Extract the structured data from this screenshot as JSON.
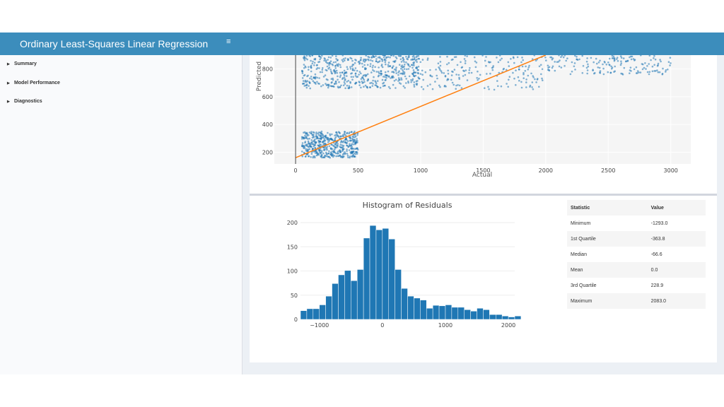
{
  "header": {
    "title": "Ordinary Least-Squares Linear Regression",
    "menu_icon": "hamburger-icon"
  },
  "sidebar": {
    "items": [
      {
        "label": "Summary",
        "icon": "caret-right-icon"
      },
      {
        "label": "Model Performance",
        "icon": "caret-right-icon"
      },
      {
        "label": "Diagnostics",
        "icon": "caret-right-icon"
      }
    ]
  },
  "colors": {
    "header": "#3c8dbc",
    "points": "#1f77b4",
    "fit_line": "#ff7f0e",
    "bars": "#1f77b4"
  },
  "chart_data": [
    {
      "type": "scatter",
      "xlabel": "Actual",
      "ylabel": "Predicted",
      "x_ticks": [
        "0",
        "500",
        "1000",
        "1500",
        "2000",
        "2500",
        "3000"
      ],
      "y_ticks": [
        "200",
        "400",
        "600",
        "800"
      ],
      "xlim": [
        -170,
        3160
      ],
      "ylim": [
        115,
        900
      ],
      "grid": true,
      "fit_line": {
        "x": [
          0,
          2000
        ],
        "y": [
          160,
          900
        ]
      },
      "clusters": [
        {
          "x": [
            50,
            500
          ],
          "y": [
            160,
            350
          ],
          "n": 500
        },
        {
          "x": [
            50,
            1000
          ],
          "y": [
            660,
            900
          ],
          "n": 550
        },
        {
          "x": [
            900,
            1980
          ],
          "y": [
            650,
            900
          ],
          "n": 200
        },
        {
          "x": [
            1950,
            3000
          ],
          "y": [
            760,
            900
          ],
          "n": 170
        }
      ]
    },
    {
      "type": "bar",
      "title": "Histogram of Residuals",
      "x_ticks": [
        "−1000",
        "0",
        "1000",
        "2000"
      ],
      "y_ticks": [
        "0",
        "50",
        "100",
        "150",
        "200"
      ],
      "xlim": [
        -1300,
        2100
      ],
      "ylim": [
        0,
        200
      ],
      "bin_start": -1300,
      "bin_width": 100,
      "values": [
        18,
        22,
        22,
        30,
        48,
        74,
        92,
        101,
        80,
        103,
        168,
        194,
        185,
        188,
        166,
        103,
        64,
        48,
        44,
        40,
        23,
        29,
        28,
        30,
        25,
        25,
        20,
        17,
        23,
        20,
        10,
        10,
        7,
        5,
        7
      ]
    }
  ],
  "stats": {
    "headers": [
      "Statistic",
      "Value"
    ],
    "rows": [
      [
        "Minimum",
        "-1293.0"
      ],
      [
        "1st Quartile",
        "-363.8"
      ],
      [
        "Median",
        "-66.6"
      ],
      [
        "Mean",
        "0.0"
      ],
      [
        "3rd Quartile",
        "228.9"
      ],
      [
        "Maximum",
        "2083.0"
      ]
    ]
  }
}
